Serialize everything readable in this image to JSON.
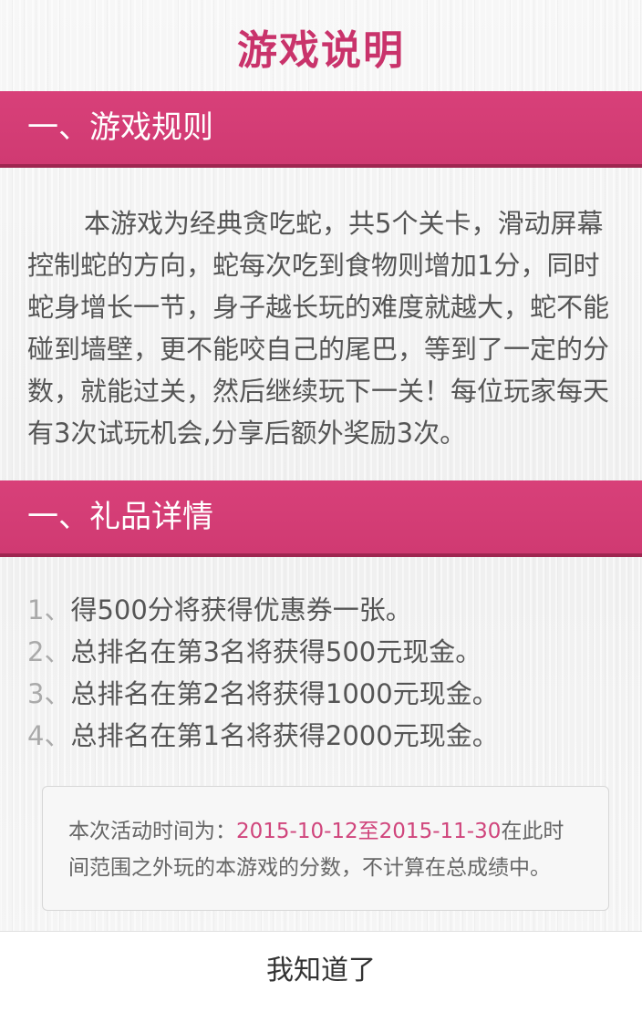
{
  "title": "游戏说明",
  "rules": {
    "heading": "一、游戏规则",
    "text": "本游戏为经典贪吃蛇，共5个关卡，滑动屏幕控制蛇的方向，蛇每次吃到食物则增加1分，同时蛇身增长一节，身子越长玩的难度就越大，蛇不能碰到墙壁，更不能咬自己的尾巴，等到了一定的分数，就能过关，然后继续玩下一关！每位玩家每天有3次试玩机会,分享后额外奖励3次。"
  },
  "gifts": {
    "heading": "一、礼品详情",
    "items": [
      {
        "num": "1、",
        "text": "得500分将获得优惠券一张。"
      },
      {
        "num": "2、",
        "text": "总排名在第3名将获得500元现金。"
      },
      {
        "num": "3、",
        "text": "总排名在第2名将获得1000元现金。"
      },
      {
        "num": "4、",
        "text": "总排名在第1名将获得2000元现金。"
      }
    ]
  },
  "notice": {
    "prefix": "本次活动时间为：",
    "date_range": "2015-10-12至2015-11-30",
    "suffix": "在此时间范围之外玩的本游戏的分数，不计算在总成绩中。"
  },
  "confirm_label": "我知道了",
  "colors": {
    "accent": "#d43c75",
    "accent_dark": "#9e2650",
    "title": "#c9336b",
    "date_highlight": "#d0457c"
  }
}
